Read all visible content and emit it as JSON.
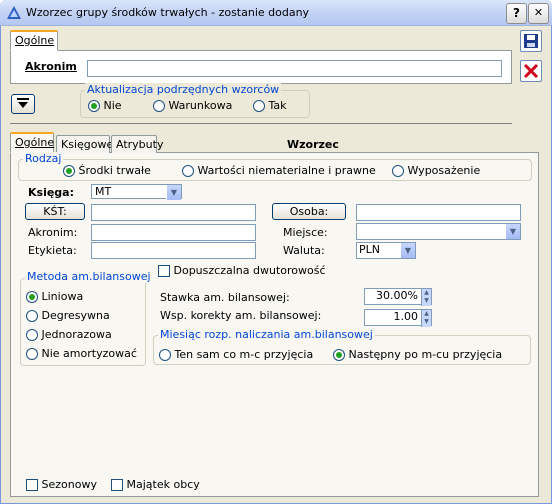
{
  "window": {
    "title": "Wzorzec grupy środków trwałych - zostanie dodany",
    "help_glyph": "?",
    "close_glyph": "✕"
  },
  "top_tab": {
    "label": "Ogólne"
  },
  "akronim": {
    "label": "Akronim",
    "value": ""
  },
  "aktualizacja": {
    "title": "Aktualizacja podrzędnych wzorców",
    "options": [
      "Nie",
      "Warunkowa",
      "Tak"
    ],
    "selected": 0
  },
  "wzorzec_label": "Wzorzec",
  "tabs": [
    "Ogólne",
    "Księgowe",
    "Atrybuty"
  ],
  "rodzaj": {
    "title": "Rodzaj",
    "options": [
      "Środki trwałe",
      "Wartości niematerialne i prawne",
      "Wyposażenie"
    ],
    "selected": 0
  },
  "form": {
    "ksiega_label": "Księga:",
    "ksiega_value": "MT",
    "kst_button": "KŚT:",
    "kst_value": "",
    "osoba_button": "Osoba:",
    "osoba_value": "",
    "akronim_label": "Akronim:",
    "akronim_value": "",
    "miejsce_label": "Miejsce:",
    "miejsce_value": "",
    "etykieta_label": "Etykieta:",
    "etykieta_value": "",
    "waluta_label": "Waluta:",
    "waluta_value": "PLN"
  },
  "metoda": {
    "title": "Metoda am.bilansowej",
    "options": [
      "Liniowa",
      "Degresywna",
      "Jednorazowa",
      "Nie amortyzować"
    ],
    "selected": 0
  },
  "dwutorowosc": {
    "label": "Dopuszczalna dwutorowość",
    "checked": false
  },
  "stawka": {
    "label": "Stawka am. bilansowej:",
    "value": "30.00%"
  },
  "wsp": {
    "label": "Wsp. korekty am. bilansowej:",
    "value": "1.00"
  },
  "miesiac": {
    "title": "Miesiąc rozp. naliczania am.bilansowej",
    "options": [
      "Ten sam co m-c przyjęcia",
      "Następny po m-cu przyjęcia"
    ],
    "selected": 1
  },
  "bottom": {
    "sezonowy": "Sezonowy",
    "majatek": "Majątek obcy"
  },
  "colors": {
    "accent": "#0046d5",
    "tab_highlight": "#f5a623",
    "radio_dot": "#21a121"
  }
}
